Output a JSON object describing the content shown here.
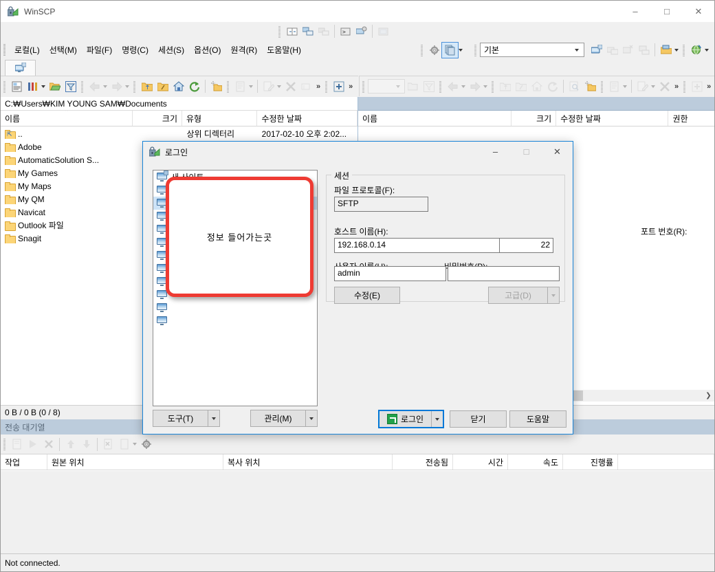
{
  "window": {
    "title": "WinSCP",
    "icon": "winscp-lock-icon",
    "minimize": "–",
    "maximize": "□",
    "close": "✕"
  },
  "menubar": {
    "items": [
      {
        "label": "로컬(L)",
        "name": "menu-local"
      },
      {
        "label": "선택(M)",
        "name": "menu-mark"
      },
      {
        "label": "파일(F)",
        "name": "menu-file"
      },
      {
        "label": "명령(C)",
        "name": "menu-commands"
      },
      {
        "label": "세션(S)",
        "name": "menu-session"
      },
      {
        "label": "옵션(O)",
        "name": "menu-options"
      },
      {
        "label": "원격(R)",
        "name": "menu-remote"
      },
      {
        "label": "도움말(H)",
        "name": "menu-help"
      }
    ]
  },
  "session_combo": {
    "value": "기본",
    "caret": "▾"
  },
  "left_panel": {
    "tab_icon": "local-computer-icon",
    "path": "C:₩Users₩KIM YOUNG SAM₩Documents",
    "columns": [
      {
        "label": "이름",
        "name": "col-name"
      },
      {
        "label": "크기",
        "name": "col-size"
      },
      {
        "label": "유형",
        "name": "col-type"
      },
      {
        "label": "수정한 날짜",
        "name": "col-modified"
      }
    ],
    "sort_indicator": "⌃",
    "rows": [
      {
        "name": "..",
        "size": "",
        "type": "상위 디렉터리",
        "date": "2017-02-10  오후 2:02...",
        "icon": "parent-folder-icon"
      },
      {
        "name": "Adobe",
        "size": "",
        "type": "",
        "date": "",
        "icon": "folder-icon"
      },
      {
        "name": "AutomaticSolution S...",
        "size": "",
        "type": "",
        "date": "",
        "icon": "folder-icon"
      },
      {
        "name": "My Games",
        "size": "",
        "type": "",
        "date": "",
        "icon": "folder-icon"
      },
      {
        "name": "My Maps",
        "size": "",
        "type": "",
        "date": "",
        "icon": "folder-icon"
      },
      {
        "name": "My QM",
        "size": "",
        "type": "",
        "date": "",
        "icon": "folder-icon"
      },
      {
        "name": "Navicat",
        "size": "",
        "type": "",
        "date": "",
        "icon": "folder-icon"
      },
      {
        "name": "Outlook 파일",
        "size": "",
        "type": "",
        "date": "",
        "icon": "folder-icon"
      },
      {
        "name": "Snagit",
        "size": "",
        "type": "",
        "date": "",
        "icon": "folder-icon"
      }
    ],
    "status": "0 B / 0 B (0 / 8)"
  },
  "right_panel": {
    "path": "",
    "columns": [
      {
        "label": "이름",
        "name": "col-name"
      },
      {
        "label": "크기",
        "name": "col-size"
      },
      {
        "label": "수정한 날짜",
        "name": "col-modified"
      },
      {
        "label": "권한",
        "name": "col-permissions"
      }
    ],
    "sort_indicator": "⌃",
    "rows": [],
    "scroll_arrow": "❯"
  },
  "queue": {
    "title": "전송 대기열",
    "columns": [
      {
        "label": "작업",
        "name": "qcol-operation"
      },
      {
        "label": "원본 위치",
        "name": "qcol-source"
      },
      {
        "label": "복사 위치",
        "name": "qcol-destination"
      },
      {
        "label": "전송됨",
        "name": "qcol-transferred"
      },
      {
        "label": "시간",
        "name": "qcol-time"
      },
      {
        "label": "속도",
        "name": "qcol-speed"
      },
      {
        "label": "진행률",
        "name": "qcol-progress"
      }
    ],
    "rows": []
  },
  "statusbar": {
    "text": "Not connected."
  },
  "dialog": {
    "title": "로그인",
    "icon": "winscp-lock-icon",
    "minimize": "–",
    "maximize": "□",
    "close": "✕",
    "tree": {
      "root_label": "새 사이트",
      "root_icon": "new-site-icon",
      "item_count": 11,
      "selected_index": 2
    },
    "session_group": "세션",
    "protocol": {
      "label": "파일 프로토콜(F):",
      "value": "SFTP"
    },
    "hostname": {
      "label": "호스트 이름(H):",
      "value": "192.168.0.14"
    },
    "port": {
      "label": "포트 번호(R):",
      "value": "22"
    },
    "username": {
      "label": "사용자 이름(U):",
      "value": "admin"
    },
    "password": {
      "label": "비밀번호(P):",
      "value": ""
    },
    "edit_button": "수정(E)",
    "advanced_button": "고급(D)",
    "tools_button": "도구(T)",
    "manage_button": "관리(M)",
    "login_button": "로그인",
    "close_button": "닫기",
    "help_button": "도움말",
    "caret": "▾"
  },
  "annotation": {
    "text": "정보 들어가는곳",
    "border_color": "#ee3b33"
  }
}
